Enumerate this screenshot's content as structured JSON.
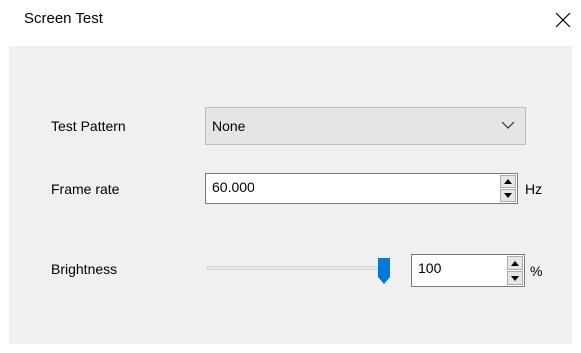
{
  "window": {
    "title": "Screen Test",
    "close_icon": "close-icon"
  },
  "form": {
    "test_pattern": {
      "label": "Test Pattern",
      "value": "None",
      "icon": "chevron-down-icon"
    },
    "frame_rate": {
      "label": "Frame rate",
      "value": "60.000",
      "unit": "Hz"
    },
    "brightness": {
      "label": "Brightness",
      "value": "100",
      "unit": "%",
      "slider_fraction": 1.0
    }
  },
  "colors": {
    "panel_bg": "#f0f0f0",
    "accent": "#0078d7"
  }
}
